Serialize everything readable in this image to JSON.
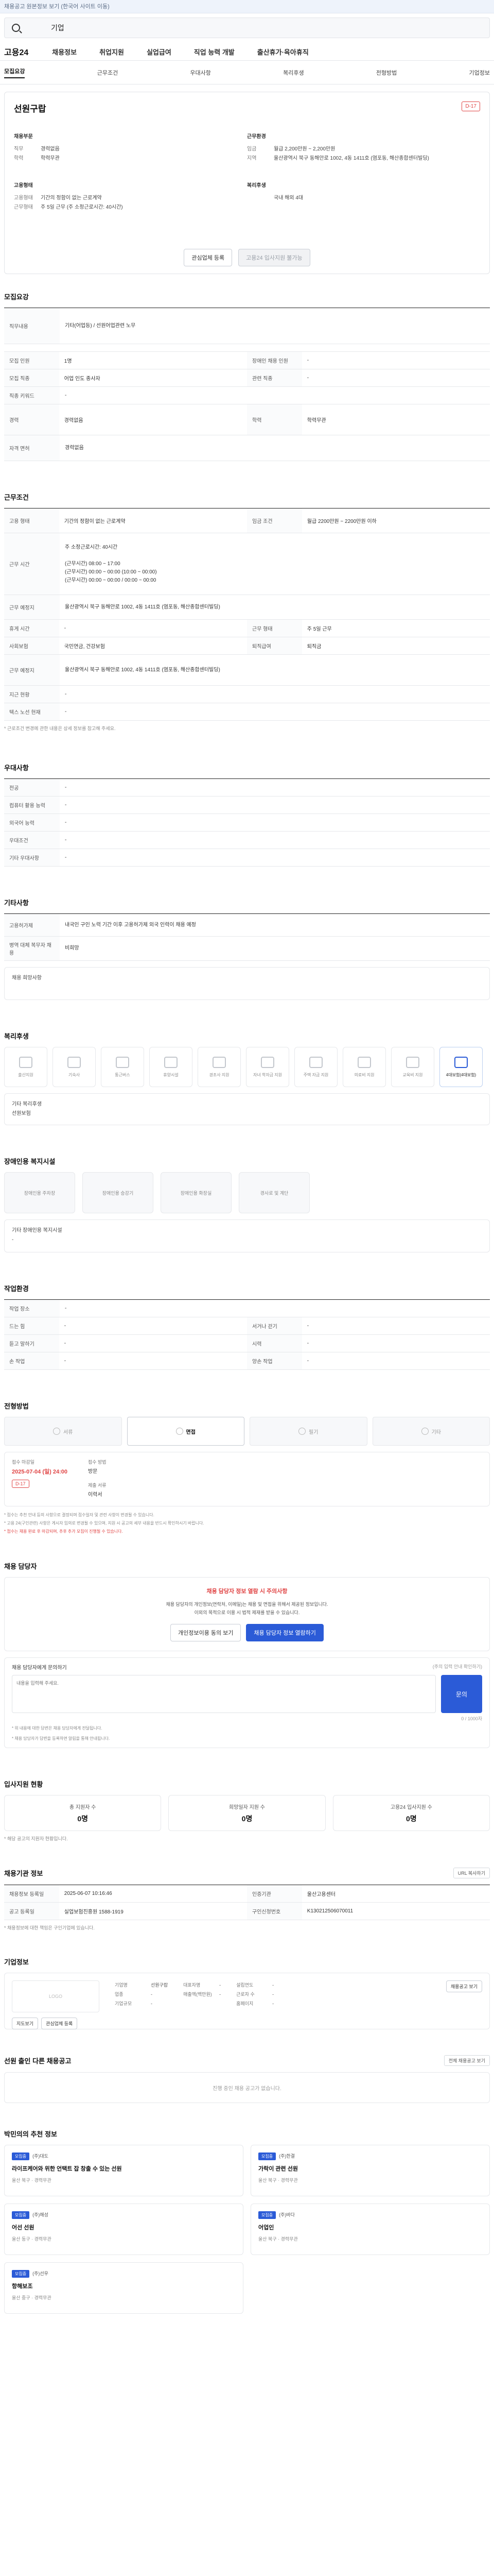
{
  "notice": "채용공고 원본정보 보기 (한국어 사이트 이동)",
  "search": {
    "value": "기업"
  },
  "gnb": {
    "logo": "고용24",
    "items": [
      "채용정보",
      "취업지원",
      "실업급여",
      "직업 능력 개발",
      "출산휴가·육아휴직"
    ]
  },
  "tabs": [
    "모집요강",
    "근무조건",
    "우대사항",
    "복리후생",
    "전형방법",
    "기업정보"
  ],
  "company": {
    "name": "선원구랍",
    "dday": "D-17",
    "left_title": "채용부문",
    "right_title": "근무환경",
    "left_rows": [
      {
        "k": "직무",
        "v": "경력없음"
      },
      {
        "k": "학력",
        "v": "학력무관"
      }
    ],
    "right_rows": [
      {
        "k": "임금",
        "v": "월급 2,200만원 ~ 2,200만원"
      },
      {
        "k": "지역",
        "v": "울산광역시 북구 동해안로 1002, 4동 1411호 (염포동, 해산종합센터빌딩)"
      }
    ],
    "left2_title": "고용형태",
    "right2_title": "복리후생",
    "left2_rows": [
      {
        "k": "고용형태",
        "v": "기간의 정함이 없는 근로계약"
      },
      {
        "k": "근무형태",
        "v": "주 5일 근무 (주 소정근로시간: 40시간)"
      }
    ],
    "right2_rows": [
      {
        "k": "",
        "v": "국내 해외 4대"
      }
    ],
    "btn_interest": "관심업체 등록",
    "btn_apply": "고용24 입사지원 불가능"
  },
  "recruit": {
    "title": "모집요강",
    "job_title_label": "직무내용",
    "job_title_value": "기타(어업등) / 선원어업관련 노무",
    "rows": [
      {
        "k1": "모집 인원",
        "v1": "1명",
        "k2": "장애인 채용 인원",
        "v2": "-"
      },
      {
        "k1": "모집 직종",
        "v1": "어업 인도 종사자",
        "k2": "관련 직종",
        "v2": "-"
      },
      {
        "k1": "직종 키워드",
        "v1": "-",
        "k2": "",
        "v2": ""
      },
      {
        "k1": "경력",
        "v1": "경력없음",
        "k2": "학력",
        "v2": "학력무관"
      },
      {
        "k1": "자격 면허",
        "v1": "경력없음",
        "k2": "",
        "v2": ""
      }
    ]
  },
  "work": {
    "title": "근무조건",
    "rows": [
      {
        "k1": "고용 형태",
        "v1": "기간의 정함이 없는 근로계약",
        "k2": "임금 조건",
        "v2": "월급 2200만원 ~ 2200만원 이하"
      },
      {
        "k1": "근무 시간",
        "v1": "주 소정근로시간: 40시간",
        "k2": "",
        "v2": ""
      },
      {
        "k1": "근무 예정지",
        "v1": "울산광역시 북구 동해안로 1002, 4동 1411호 (염포동, 해산종합센터빌딩)",
        "k2": "",
        "v2": ""
      },
      {
        "k1": "휴게 시간",
        "v1": "-",
        "k2": "근무 형태",
        "v2": "주 5일 근무"
      },
      {
        "k1": "사회보험",
        "v1": "국민연금, 건강보험",
        "k2": "퇴직급여",
        "v2": "퇴직금"
      },
      {
        "k1": "근무 예정지",
        "v1": "울산광역시 북구 동해안로 1002, 4동 1411호 (염포동, 해산종합센터빌딩)",
        "k2": "",
        "v2": ""
      },
      {
        "k1": "지근 현황",
        "v1": "-",
        "k2": "",
        "v2": ""
      },
      {
        "k1": "텍스 노선 현재",
        "v1": "-",
        "k2": "",
        "v2": ""
      }
    ],
    "work_time_detail": "(근무시간) 08:00 ~ 17:00\n(근무시간) 00:00 ~ 00:00 (10:00 ~ 00:00)\n(근무시간) 00:00 ~ 00:00 / 00:00 ~ 00:00",
    "note": "* 근로조건 변경에 관한 내용은 상세 정보를 참고해 주세요."
  },
  "preference": {
    "title": "우대사항",
    "rows": [
      {
        "k": "전공",
        "v": "-"
      },
      {
        "k": "컴퓨터 활용 능력",
        "v": "-"
      },
      {
        "k": "외국어 능력",
        "v": "-"
      },
      {
        "k": "우대조건",
        "v": "-"
      },
      {
        "k": "기타 우대사항",
        "v": "-"
      }
    ]
  },
  "etc": {
    "title": "기타사항",
    "rows": [
      {
        "k": "고용허가제",
        "v": "내국인 구인 노력 기간 이후 고용허가제 외국 인력이 채용 예정"
      },
      {
        "k": "병역 대체 복무자 채용",
        "v": "비희망"
      }
    ],
    "extra": "채용 희망사항"
  },
  "welfare": {
    "title": "복리후생",
    "items": [
      {
        "label": "출산지원",
        "on": false
      },
      {
        "label": "기숙사",
        "on": false
      },
      {
        "label": "통근버스",
        "on": false
      },
      {
        "label": "휴양시설",
        "on": false
      },
      {
        "label": "경조사 지원",
        "on": false
      },
      {
        "label": "자녀 학자금 지원",
        "on": false
      },
      {
        "label": "주택 자금 지원",
        "on": false
      },
      {
        "label": "의료비 지원",
        "on": false
      },
      {
        "label": "교육비 지원",
        "on": false
      },
      {
        "label": "4대보험(4대보험)",
        "on": true
      }
    ],
    "etc_label": "기타 복리후생",
    "etc_value": "선원보험"
  },
  "disability": {
    "title": "장애인용 복지시설",
    "items": [
      "장애인용 주차장",
      "장애인용 승강기",
      "장애인용 화장실",
      "경사로 및 계단"
    ],
    "etc_label": "기타 장애인용 복지시설",
    "etc_value": "-"
  },
  "env": {
    "title": "작업환경",
    "rows": [
      {
        "k1": "작업 장소",
        "v1": "-",
        "k2": "",
        "v2": ""
      },
      {
        "k1": "드는 힘",
        "v1": "-",
        "k2": "서거나 걷기",
        "v2": "-"
      },
      {
        "k1": "듣고 말하기",
        "v1": "-",
        "k2": "시력",
        "v2": "-"
      },
      {
        "k1": "손 작업",
        "v1": "-",
        "k2": "양손 작업",
        "v2": "-"
      }
    ]
  },
  "process": {
    "title": "전형방법",
    "steps": [
      "서류",
      "면접",
      "필기",
      "기타"
    ],
    "active": 1,
    "deadline_label": "접수 마감일",
    "deadline_date": "2025-07-04 (일) 24:00",
    "deadline_badge": "D-17",
    "method_label": "접수 방법",
    "method_value": "방문",
    "docs_label": "제출 서류",
    "docs_value": "이력서",
    "note1": "* 접수는 추천 안내 등의 사항으로 결정되며 접수일자 및 관련 사항이 변경될 수 있습니다.",
    "note2": "* 고용 24(구인관련) 사항은 게시자 임의로 변경될 수 있으며, 지원 시 공고의 세부 내용을 반드시 확인하시기 바랍니다.",
    "note3": "* 접수는 채용 완료 후 마감되며, 추후 추가 모집이 진행될 수 있습니다."
  },
  "contact": {
    "title": "채용 담당자",
    "alert": "채용 담당자 정보 열람 시 주의사항",
    "desc": "채용 담당자의 개인정보(연락처, 이메일)는 채용 및 면접을 위해서 제공된 정보입니다.\n이외의 목적으로 이용 시 법적 제재를 받을 수 있습니다.",
    "btn_consent": "개인정보이용 동의 보기",
    "btn_view": "채용 담당자 정보 열람하기",
    "inq_title": "채용 담당자에게 문의하기",
    "inq_right": "(주의 입력 안내 확인하기)",
    "inq_placeholder": "내용을 입력해 주세요.",
    "inq_btn": "문의",
    "inq_count": "0 / 1000자",
    "inq_note1": "* 위 내용에 대한 답변은 채용 담당자에게 전달됩니다.",
    "inq_note2": "* 채용 담당자가 답변을 등록하면 알림을 통해 안내됩니다."
  },
  "applicants": {
    "title": "입사지원 현황",
    "cards": [
      {
        "label": "총 지원자 수",
        "value": "0명"
      },
      {
        "label": "희망일자 지원 수",
        "value": "0명"
      },
      {
        "label": "고용24 입사지원 수",
        "value": "0명"
      }
    ],
    "note": "* 해당 공고의 지원자 현황입니다."
  },
  "info": {
    "title": "채용기관 정보",
    "copy_btn": "URL 복사하기",
    "rows": [
      {
        "k1": "채용정보 등록일",
        "v1": "2025-06-07 10:16:46",
        "k2": "인증기관",
        "v2": "울산고용센터"
      },
      {
        "k1": "공고 등록일",
        "v1": "실업보험진흥원 1588-1919",
        "k2": "구인신청번호",
        "v2": "K130212506070011"
      }
    ],
    "note": "* 채용정보에 대한 책임은 구인기업에 있습니다."
  },
  "company2": {
    "title": "기업정보",
    "logo": "LOGO",
    "col1": [
      {
        "k": "기업명",
        "v": "선원구랍"
      },
      {
        "k": "업종",
        "v": "-"
      },
      {
        "k": "기업규모",
        "v": "-"
      }
    ],
    "col2": [
      {
        "k": "대표자명",
        "v": "-"
      },
      {
        "k": "매출액(백만원)",
        "v": "-"
      }
    ],
    "col3": [
      {
        "k": "설립연도",
        "v": "-"
      },
      {
        "k": "근로자 수",
        "v": "-"
      },
      {
        "k": "홈페이지",
        "v": "-"
      }
    ],
    "btn_map": "지도보기",
    "btn_interest": "관심업체 등록",
    "btn_list": "채용공고 보기"
  },
  "other": {
    "title": "선원 출인 다른 채용공고",
    "empty": "진행 중인 채용 공고가 없습니다.",
    "right": "전체 채용공고 보기"
  },
  "recommend": {
    "title": "박민의의 추천 정보",
    "cards": [
      {
        "badge": "모집중",
        "company": "(주)대도",
        "title": "라이프케어와 위한 언택트 잡 창출 수 있는 선원",
        "meta": "울산 북구 · 경력무관"
      },
      {
        "badge": "모집중",
        "company": "(주)한결",
        "title": "가락이 관련 선원",
        "meta": "울산 북구 · 경력무관"
      },
      {
        "badge": "모집중",
        "company": "(주)해성",
        "title": "어선 선원",
        "meta": "울산 동구 · 경력무관"
      },
      {
        "badge": "모집중",
        "company": "(주)바다",
        "title": "어업인",
        "meta": "울산 북구 · 경력무관"
      },
      {
        "badge": "모집중",
        "company": "(주)선우",
        "title": "항해보조",
        "meta": "울산 중구 · 경력무관"
      }
    ]
  }
}
